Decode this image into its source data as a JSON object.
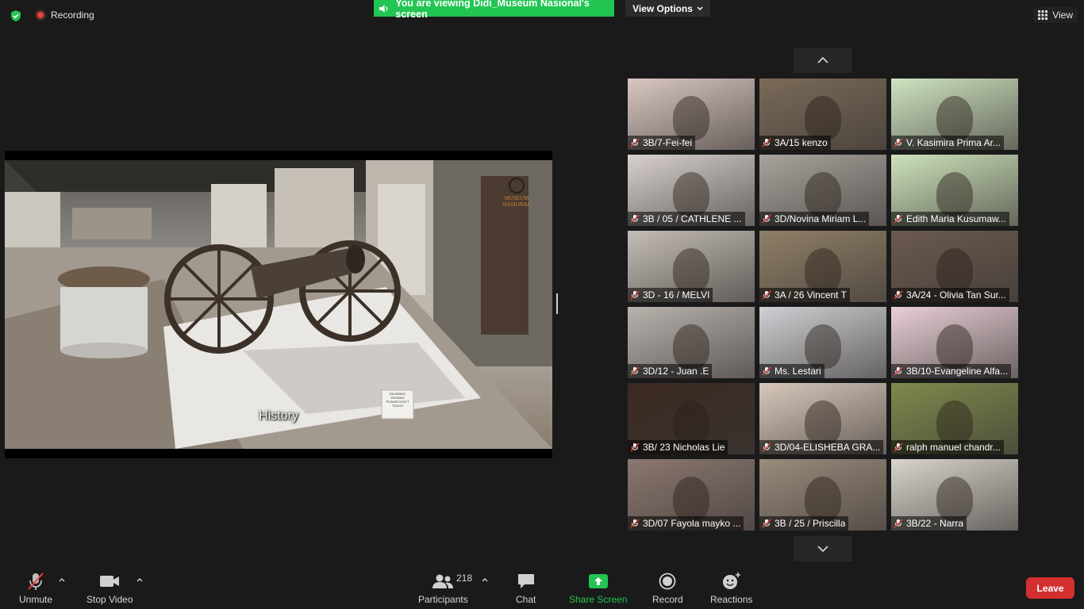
{
  "top": {
    "recording_label": "Recording",
    "viewing_banner": "You are viewing Didi_Museum Nasional's screen",
    "view_options_label": "View Options",
    "view_label": "View"
  },
  "share": {
    "caption": "History",
    "logo_line1": "MUSEUM",
    "logo_line2": "NASIONAL",
    "sign_text": "DILARANG PEGANG",
    "sign_text2": "PLEASE DON'T TOUCH"
  },
  "participants_tiles": [
    {
      "name": "3B/7-Fei-fei",
      "bg": "#d9c7c2"
    },
    {
      "name": "3A/15 kenzo",
      "bg": "#7a6a58"
    },
    {
      "name": "V. Kasimira Prima Ar...",
      "bg": "#cfe3c0"
    },
    {
      "name": "3B / 05 / CATHLENE ...",
      "bg": "#d8d1cd"
    },
    {
      "name": "3D/Novina Miriam L...",
      "bg": "#a9a39d"
    },
    {
      "name": "Edith Maria Kusumaw...",
      "bg": "#cde2bb"
    },
    {
      "name": "3D - 16 / MELVI",
      "bg": "#c4bdb6"
    },
    {
      "name": "3A / 26 Vincent T",
      "bg": "#8f7f67"
    },
    {
      "name": "3A/24 - Olivia Tan Sur...",
      "bg": "#6b5a4f"
    },
    {
      "name": "3D/12 - Juan .E",
      "bg": "#b9b3ae"
    },
    {
      "name": "Ms. Lestari",
      "bg": "#cfd0d4"
    },
    {
      "name": "3B/10-Evangeline Alfa...",
      "bg": "#e8cfd6"
    },
    {
      "name": "3B/ 23 Nicholas Lie",
      "bg": "#3b2a22"
    },
    {
      "name": "3D/04-ELISHEBA GRA...",
      "bg": "#d8c8bb"
    },
    {
      "name": "ralph manuel chandr...",
      "bg": "#7d8a4c"
    },
    {
      "name": "3D/07 Fayola mayko ...",
      "bg": "#8b7770"
    },
    {
      "name": "3B / 25 / Priscilla",
      "bg": "#9a8b7c"
    },
    {
      "name": "3B/22 - Narra",
      "bg": "#d9d4cc"
    }
  ],
  "toolbar": {
    "unmute_label": "Unmute",
    "stop_video_label": "Stop Video",
    "participants_label": "Participants",
    "participants_count": "218",
    "chat_label": "Chat",
    "share_screen_label": "Share Screen",
    "record_label": "Record",
    "reactions_label": "Reactions",
    "leave_label": "Leave"
  },
  "colors": {
    "banner_green": "#23c552",
    "share_green": "#23c552",
    "leave_red": "#d32f2f",
    "background": "#1a1a1a"
  }
}
